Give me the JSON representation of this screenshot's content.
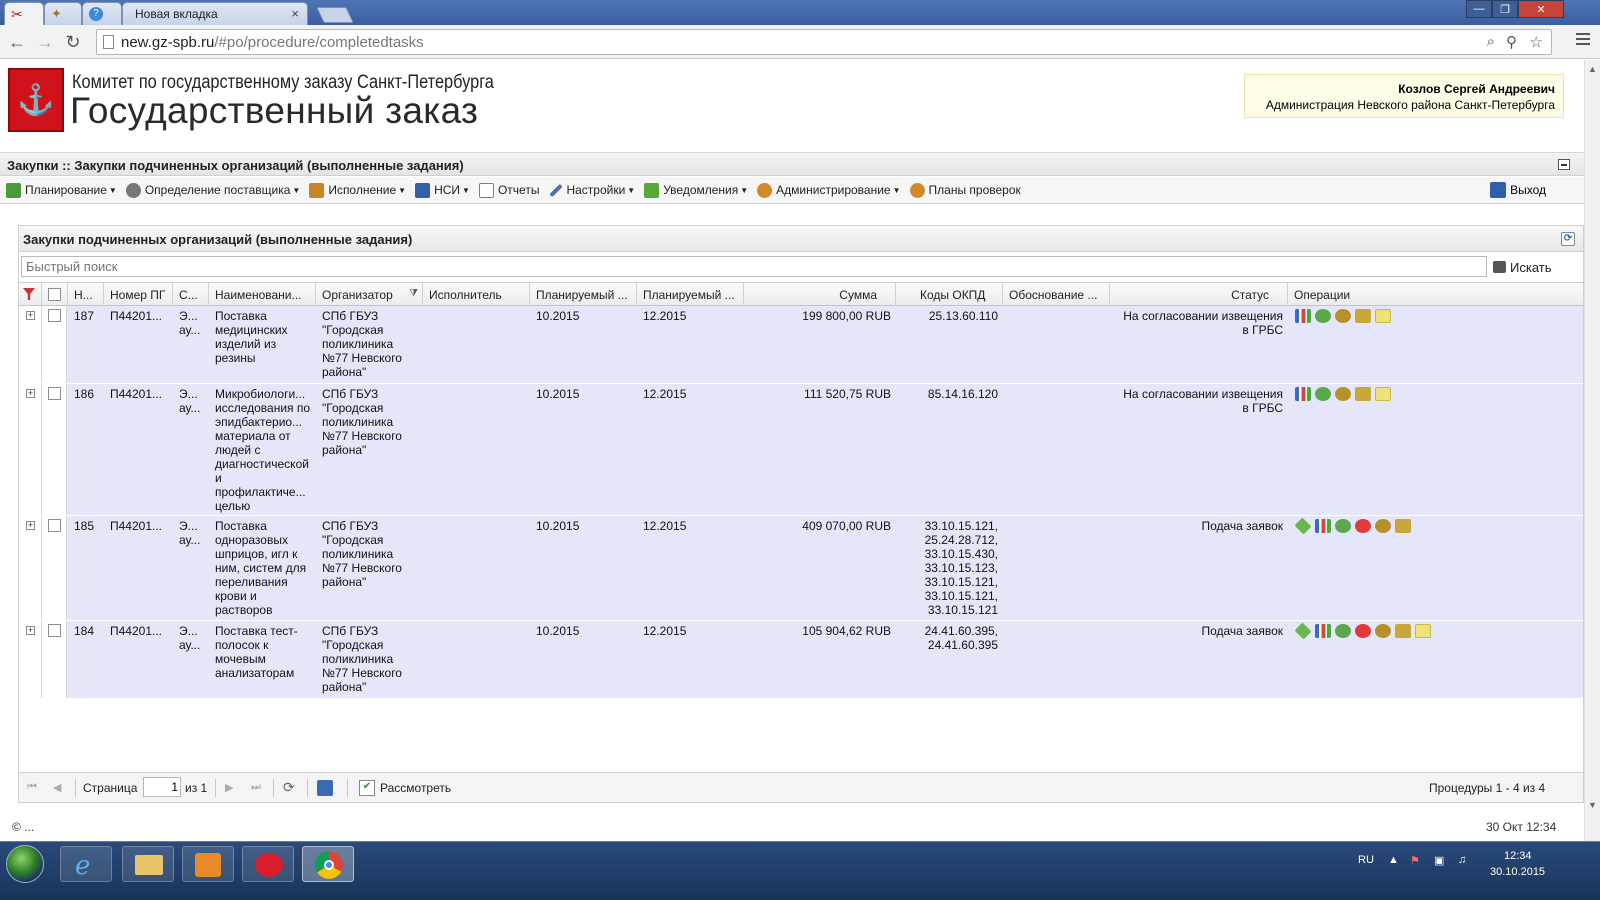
{
  "browser": {
    "tabs": [
      {
        "label": "",
        "icon": "tool-icon",
        "active": true
      },
      {
        "label": "",
        "icon": "emblem-icon",
        "active": false
      },
      {
        "label": "",
        "icon": "help-icon",
        "active": false
      },
      {
        "label": "Новая вкладка",
        "icon": "",
        "active": false
      }
    ],
    "url_domain": "new.gz-spb.ru",
    "url_path": "/#po/procedure/completedtasks"
  },
  "header": {
    "org_line1": "Комитет по государственному заказу Санкт-Петербурга",
    "org_line2": "Государственный заказ",
    "user_name": "Козлов Сергей Андреевич",
    "user_org": "Администрация Невского района Санкт-Петербурга"
  },
  "titlebar": {
    "text": "Закупки :: Закупки подчиненных организаций (выполненные задания)"
  },
  "menu": {
    "items": [
      {
        "label": "Планирование",
        "dropdown": true,
        "color": "#4a9a3a"
      },
      {
        "label": "Определение поставщика",
        "dropdown": true,
        "color": "#777777"
      },
      {
        "label": "Исполнение",
        "dropdown": true,
        "color": "#c8862a"
      },
      {
        "label": "НСИ",
        "dropdown": true,
        "color": "#3460a8"
      },
      {
        "label": "Отчеты",
        "dropdown": false,
        "color": "#7a7a9a"
      },
      {
        "label": "Настройки",
        "dropdown": true,
        "color": "#4f6fa8"
      },
      {
        "label": "Уведомления",
        "dropdown": true,
        "color": "#5aa83a"
      },
      {
        "label": "Администрирование",
        "dropdown": true,
        "color": "#d08a2a"
      },
      {
        "label": "Планы проверок",
        "dropdown": false,
        "color": "#d08a2a"
      }
    ],
    "exit_label": "Выход"
  },
  "panel": {
    "title": "Закупки подчиненных организаций (выполненные задания)",
    "search_placeholder": "Быстрый поиск",
    "search_button": "Искать"
  },
  "grid": {
    "columns": [
      "Н...",
      "Номер ПГ",
      "С...",
      "Наименовани...",
      "Организатор",
      "Исполнитель",
      "Планируемый ...",
      "Планируемый ...",
      "Сумма",
      "Коды ОКПД",
      "Обоснование ...",
      "Статус",
      "Операции"
    ],
    "rows": [
      {
        "n": "187",
        "num": "П44201...",
        "s": "Э... ау...",
        "name": "Поставка медицинских изделий из резины",
        "org": "СПб ГБУЗ \"Городская поликлиника №77 Невского района\"",
        "exec": "",
        "plan1": "10.2015",
        "plan2": "12.2015",
        "sum": "199 800,00 RUB",
        "okpd": "25.13.60.110",
        "basis": "",
        "status": "На согласовании извещения в ГРБС",
        "ops": [
          "chart",
          "gears",
          "emblem",
          "scroll",
          "docs"
        ]
      },
      {
        "n": "186",
        "num": "П44201...",
        "s": "Э... ау...",
        "name": "Микробиологи... исследования по эпидбактерио... материала от людей с диагностической и профилактиче... целью",
        "org": "СПб ГБУЗ \"Городская поликлиника №77 Невского района\"",
        "exec": "",
        "plan1": "10.2015",
        "plan2": "12.2015",
        "sum": "111 520,75 RUB",
        "okpd": "85.14.16.120",
        "basis": "",
        "status": "На согласовании извещения в ГРБС",
        "ops": [
          "chart",
          "gears",
          "emblem",
          "scroll",
          "docs"
        ]
      },
      {
        "n": "185",
        "num": "П44201...",
        "s": "Э... ау...",
        "name": "Поставка одноразовых шприцов, игл к ним, систем для переливания крови и растворов",
        "org": "СПб ГБУЗ \"Городская поликлиника №77 Невского района\"",
        "exec": "",
        "plan1": "10.2015",
        "plan2": "12.2015",
        "sum": "409 070,00 RUB",
        "okpd": "33.10.15.121, 25.24.28.712, 33.10.15.430, 33.10.15.123, 33.10.15.121, 33.10.15.121, 33.10.15.121",
        "basis": "",
        "status": "Подача заявок",
        "ops": [
          "tag",
          "chart",
          "gears",
          "stop",
          "emblem",
          "scroll"
        ]
      },
      {
        "n": "184",
        "num": "П44201...",
        "s": "Э... ау...",
        "name": "Поставка тест-полосок к мочевым анализаторам",
        "org": "СПб ГБУЗ \"Городская поликлиника №77 Невского района\"",
        "exec": "",
        "plan1": "10.2015",
        "plan2": "12.2015",
        "sum": "105 904,62 RUB",
        "okpd": "24.41.60.395, 24.41.60.395",
        "basis": "",
        "status": "Подача заявок",
        "ops": [
          "tag",
          "chart",
          "gears",
          "stop",
          "emblem",
          "scroll",
          "docs"
        ]
      }
    ]
  },
  "pager": {
    "page_label": "Страница",
    "page_value": "1",
    "of_label": "из 1",
    "view_label": "Рассмотреть",
    "summary": "Процедуры 1 - 4 из 4"
  },
  "footer": {
    "copyright": "© ...",
    "datetime": "30 Окт 12:34"
  },
  "taskbar": {
    "lang": "RU",
    "time": "12:34",
    "date": "30.10.2015"
  }
}
